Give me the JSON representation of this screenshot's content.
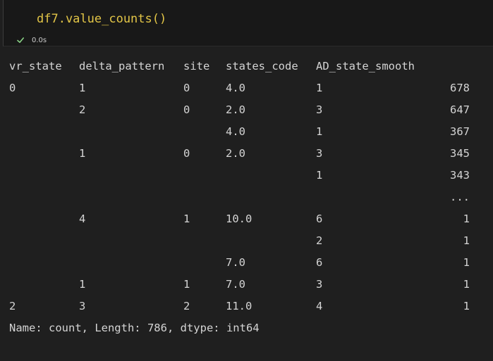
{
  "cell": {
    "code": "df7.value_counts()",
    "exec_time": "0.0s",
    "status_icon": "check-icon"
  },
  "output": {
    "headers": [
      "vr_state",
      "delta_pattern",
      "site",
      "states_code",
      "AD_state_smooth"
    ],
    "rows": [
      {
        "vr_state": "0",
        "delta_pattern": "1",
        "site": "0",
        "states_code": "4.0",
        "ad": "1",
        "count": "678"
      },
      {
        "vr_state": "",
        "delta_pattern": "2",
        "site": "0",
        "states_code": "2.0",
        "ad": "3",
        "count": "647"
      },
      {
        "vr_state": "",
        "delta_pattern": "",
        "site": "",
        "states_code": "4.0",
        "ad": "1",
        "count": "367"
      },
      {
        "vr_state": "",
        "delta_pattern": "1",
        "site": "0",
        "states_code": "2.0",
        "ad": "3",
        "count": "345"
      },
      {
        "vr_state": "",
        "delta_pattern": "",
        "site": "",
        "states_code": "",
        "ad": "1",
        "count": "343"
      },
      {
        "vr_state": "",
        "delta_pattern": "",
        "site": "",
        "states_code": "",
        "ad": "",
        "count": "..."
      },
      {
        "vr_state": "",
        "delta_pattern": "4",
        "site": "1",
        "states_code": "10.0",
        "ad": "6",
        "count": "1"
      },
      {
        "vr_state": "",
        "delta_pattern": "",
        "site": "",
        "states_code": "",
        "ad": "2",
        "count": "1"
      },
      {
        "vr_state": "",
        "delta_pattern": "",
        "site": "",
        "states_code": "7.0",
        "ad": "6",
        "count": "1"
      },
      {
        "vr_state": "",
        "delta_pattern": "1",
        "site": "1",
        "states_code": "7.0",
        "ad": "3",
        "count": "1"
      },
      {
        "vr_state": "2",
        "delta_pattern": "3",
        "site": "2",
        "states_code": "11.0",
        "ad": "4",
        "count": "1"
      }
    ],
    "footer": "Name: count, Length: 786, dtype: int64"
  }
}
